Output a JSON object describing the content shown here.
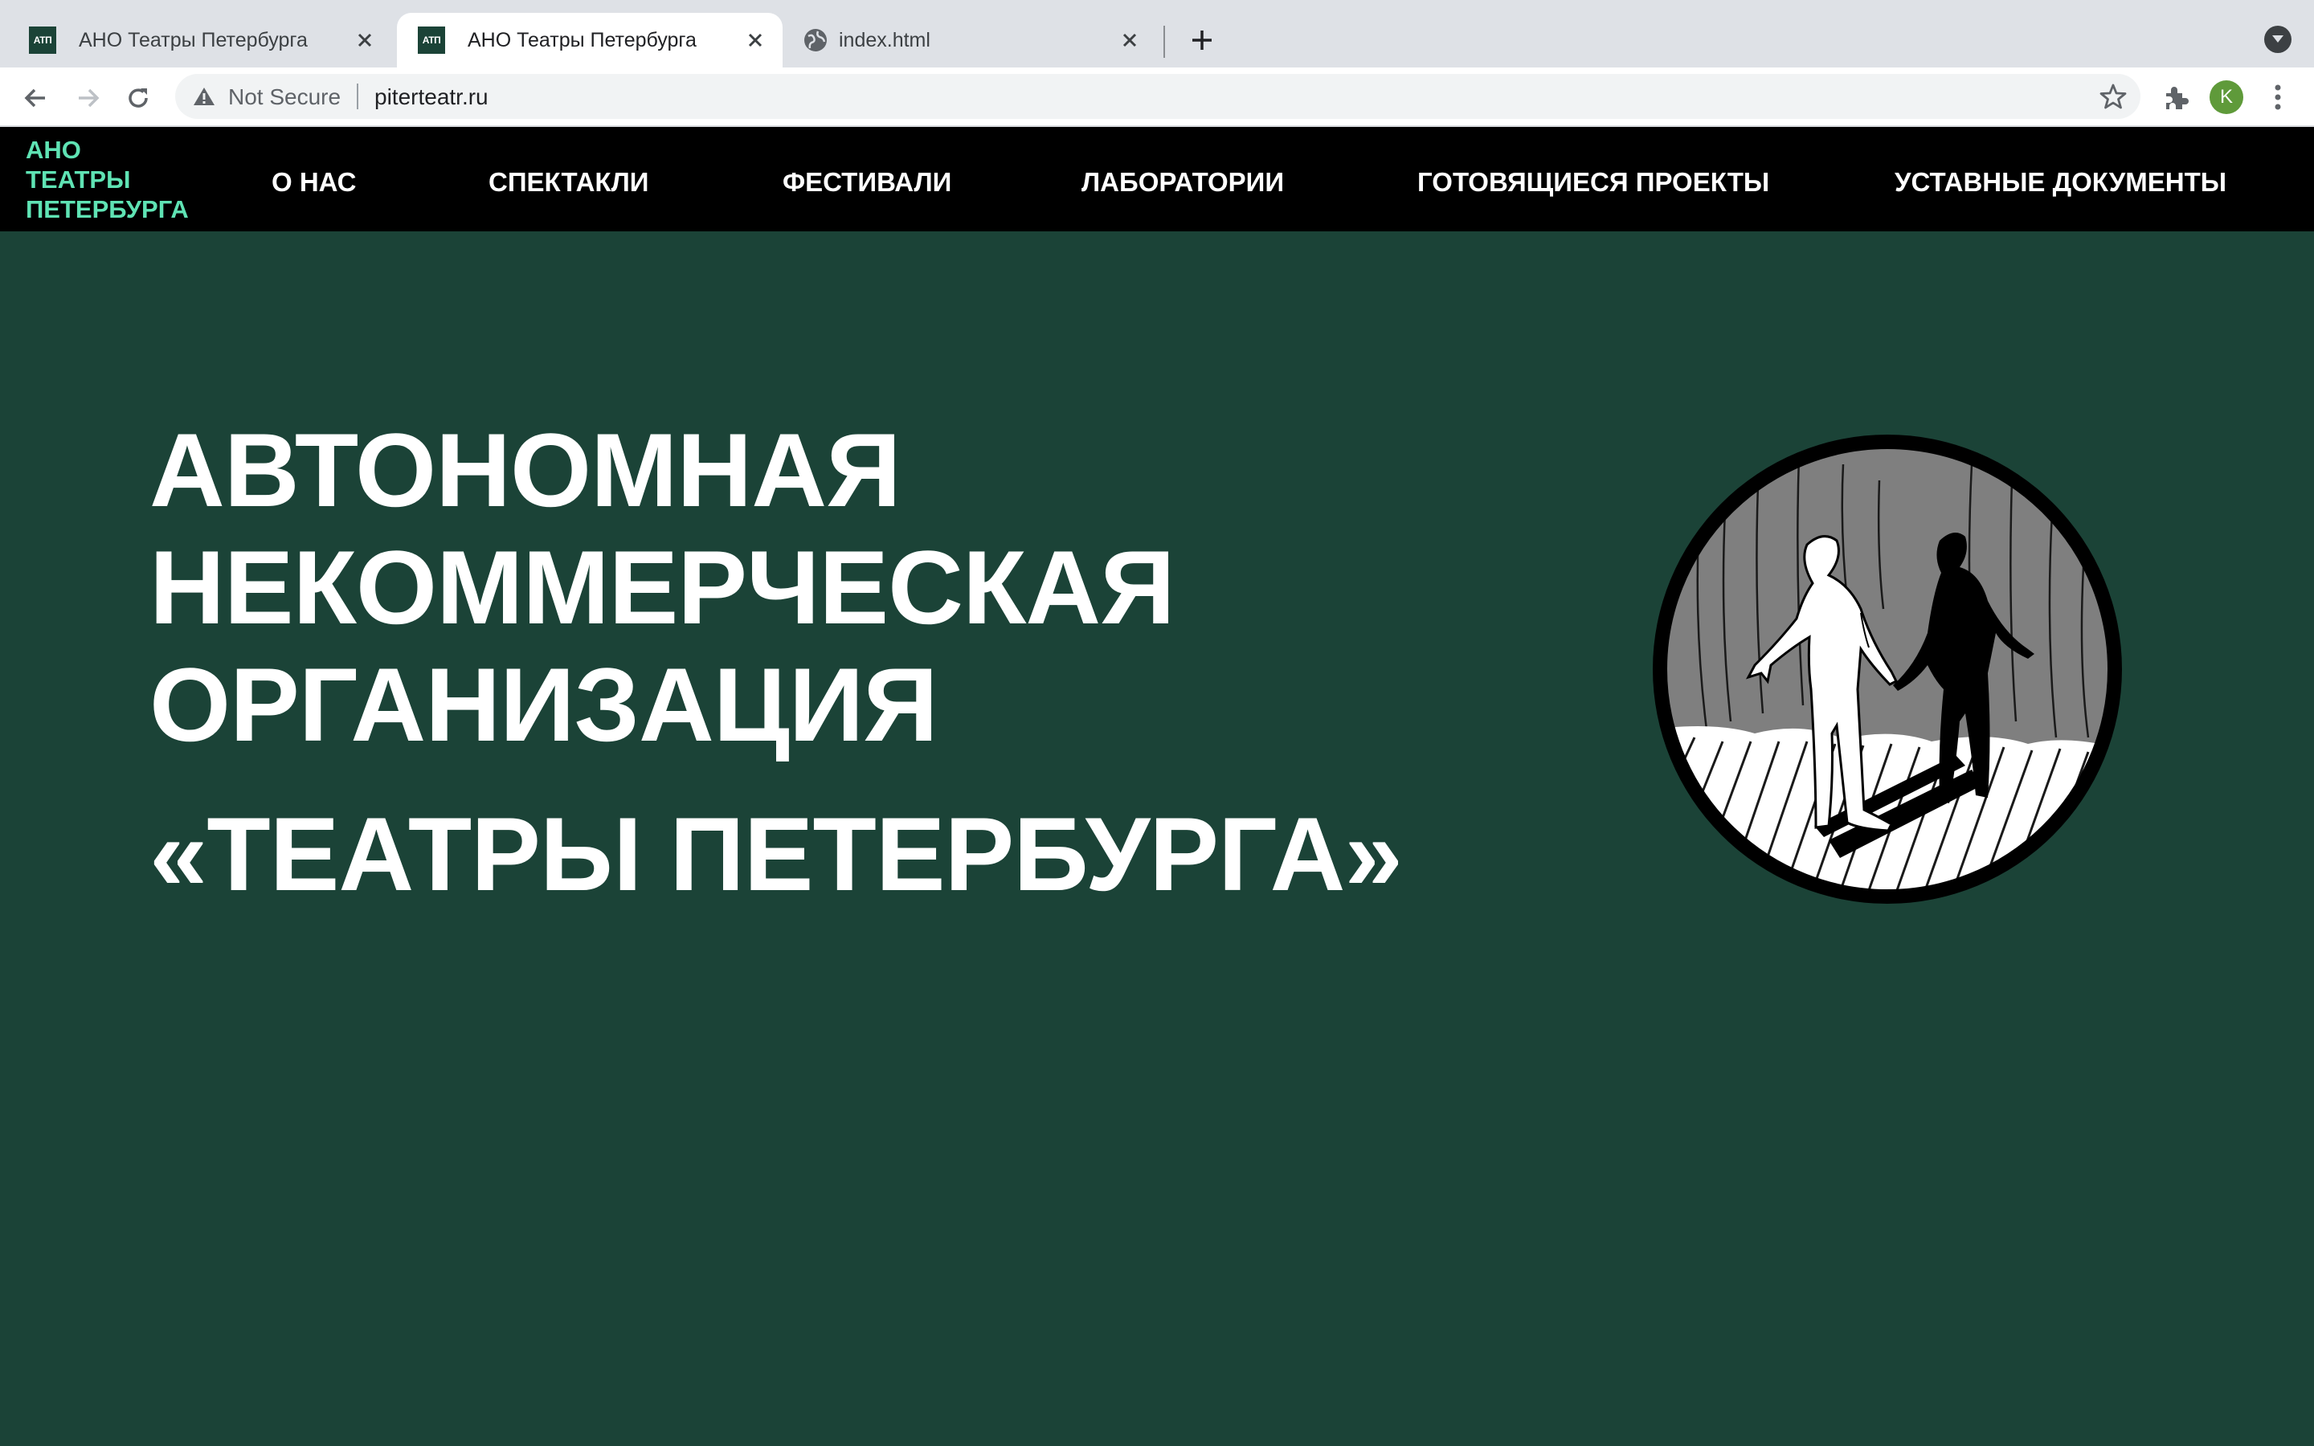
{
  "browser": {
    "tabs": [
      {
        "title": "АНО Театры Петербурга",
        "favicon": "atp-favicon",
        "active": false
      },
      {
        "title": "АНО Театры Петербурга",
        "favicon": "atp-favicon",
        "active": true
      },
      {
        "title": "index.html",
        "favicon": "globe-icon",
        "active": false
      }
    ],
    "favicon_text": "АТП",
    "security_label": "Not Secure",
    "url": "piterteatr.ru",
    "profile_initial": "K"
  },
  "site": {
    "logo_lines": [
      "АНО",
      "ТЕАТРЫ",
      "ПЕТЕРБУРГА"
    ],
    "nav": [
      "О НАС",
      "СПЕКТАКЛИ",
      "ФЕСТИВАЛИ",
      "ЛАБОРАТОРИИ",
      "ГОТОВЯЩИЕСЯ ПРОЕКТЫ",
      "УСТАВНЫЕ ДОКУМЕНТЫ"
    ],
    "hero": {
      "title_lines": [
        "АВТОНОМНАЯ",
        "НЕКОММЕРЧЕСКАЯ",
        "ОРГАНИЗАЦИЯ"
      ],
      "subtitle": "«ТЕАТРЫ ПЕТЕРБУРГА»"
    }
  },
  "colors": {
    "background": "#1b4337",
    "header": "#000000",
    "logo": "#5fe3b4",
    "text": "#ffffff"
  }
}
